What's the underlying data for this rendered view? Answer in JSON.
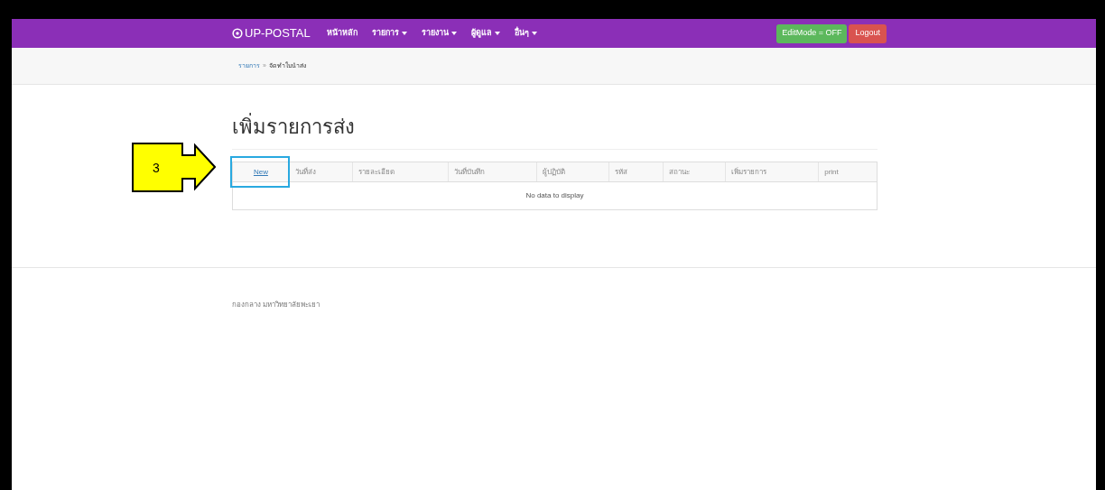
{
  "navbar": {
    "brand": "UP-POSTAL",
    "items": [
      {
        "label": "หน้าหลัก",
        "dropdown": false
      },
      {
        "label": "รายการ",
        "dropdown": true
      },
      {
        "label": "รายงาน",
        "dropdown": true
      },
      {
        "label": "ผู้ดูแล",
        "dropdown": true
      },
      {
        "label": "อื่นๆ",
        "dropdown": true
      }
    ],
    "edit_mode_button": "EditMode = OFF",
    "logout_button": "Logout"
  },
  "breadcrumb": {
    "link": "รายการ",
    "separator": "»",
    "current": "จัดทำใบนำส่ง"
  },
  "heading": "เพิ่มรายการส่ง",
  "table": {
    "columns": [
      {
        "label": "New",
        "kind": "link"
      },
      {
        "label": "วันที่ส่ง",
        "kind": "text"
      },
      {
        "label": "รายละเอียด",
        "kind": "text"
      },
      {
        "label": "วันที่บันทึก",
        "kind": "text"
      },
      {
        "label": "ผู้ปฏิบัติ",
        "kind": "text"
      },
      {
        "label": "รหัส",
        "kind": "text"
      },
      {
        "label": "สถานะ",
        "kind": "text"
      },
      {
        "label": "เพิ่มรายการ",
        "kind": "text"
      },
      {
        "label": "print",
        "kind": "text"
      }
    ],
    "empty_message": "No data to display"
  },
  "annotation": {
    "number": "3"
  },
  "footer": "กองกลาง มหาวิทยาลัยพะเยา"
}
